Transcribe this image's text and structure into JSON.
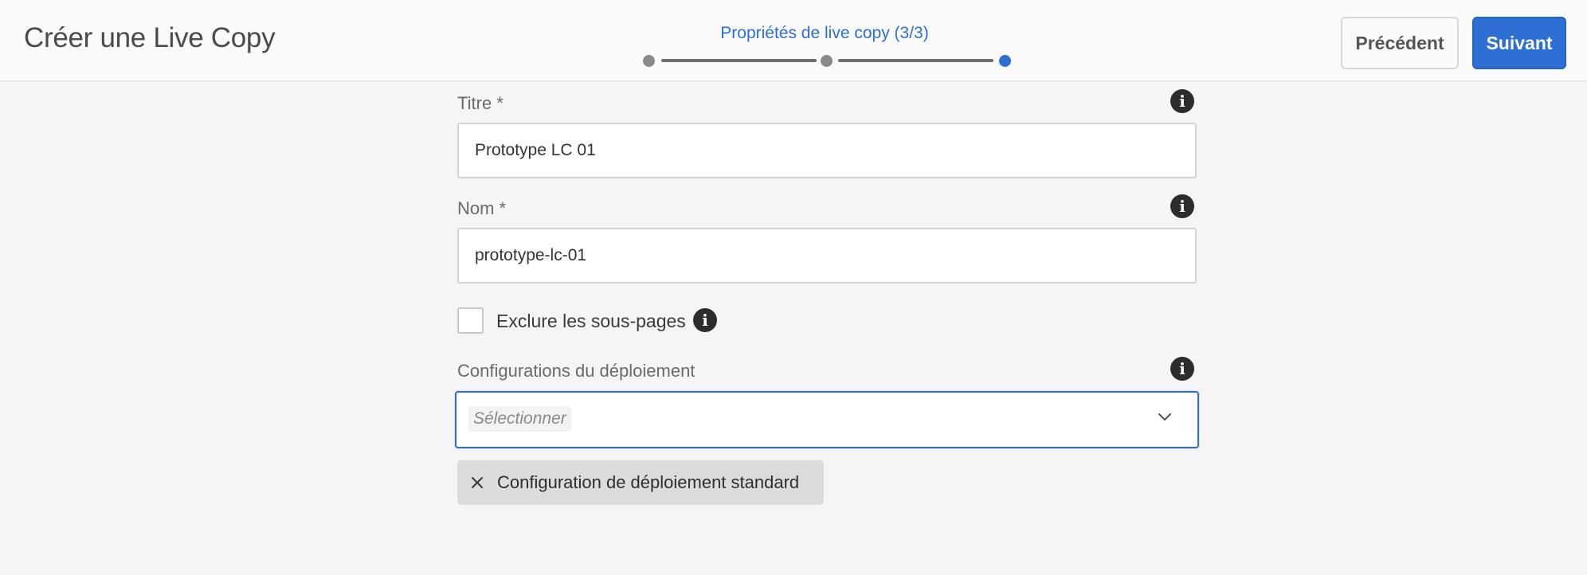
{
  "header": {
    "title": "Créer une Live Copy",
    "wizard": {
      "current_step_label": "Propriétés de live copy (3/3)",
      "steps": [
        {
          "state": "completed"
        },
        {
          "state": "completed"
        },
        {
          "state": "current"
        }
      ]
    },
    "buttons": {
      "previous_label": "Précédent",
      "next_label": "Suivant"
    }
  },
  "form": {
    "title_field": {
      "label": "Titre *",
      "value": "Prototype LC 01",
      "icon": "info-icon"
    },
    "name_field": {
      "label": "Nom *",
      "value": "prototype-lc-01",
      "icon": "info-icon"
    },
    "exclude_subpages": {
      "label": "Exclure les sous-pages",
      "checked": false,
      "icon": "info-icon"
    },
    "rollout_configs": {
      "label": "Configurations du déploiement",
      "placeholder": "Sélectionner",
      "icon": "info-icon",
      "selected_tags": [
        {
          "label": "Configuration de déploiement standard",
          "icon": "close-icon"
        }
      ]
    }
  },
  "colors": {
    "accent": "#2d6fd2",
    "background": "#f5f5f5",
    "header_bg": "#fafafa",
    "tag_bg": "#dcdcdc"
  }
}
